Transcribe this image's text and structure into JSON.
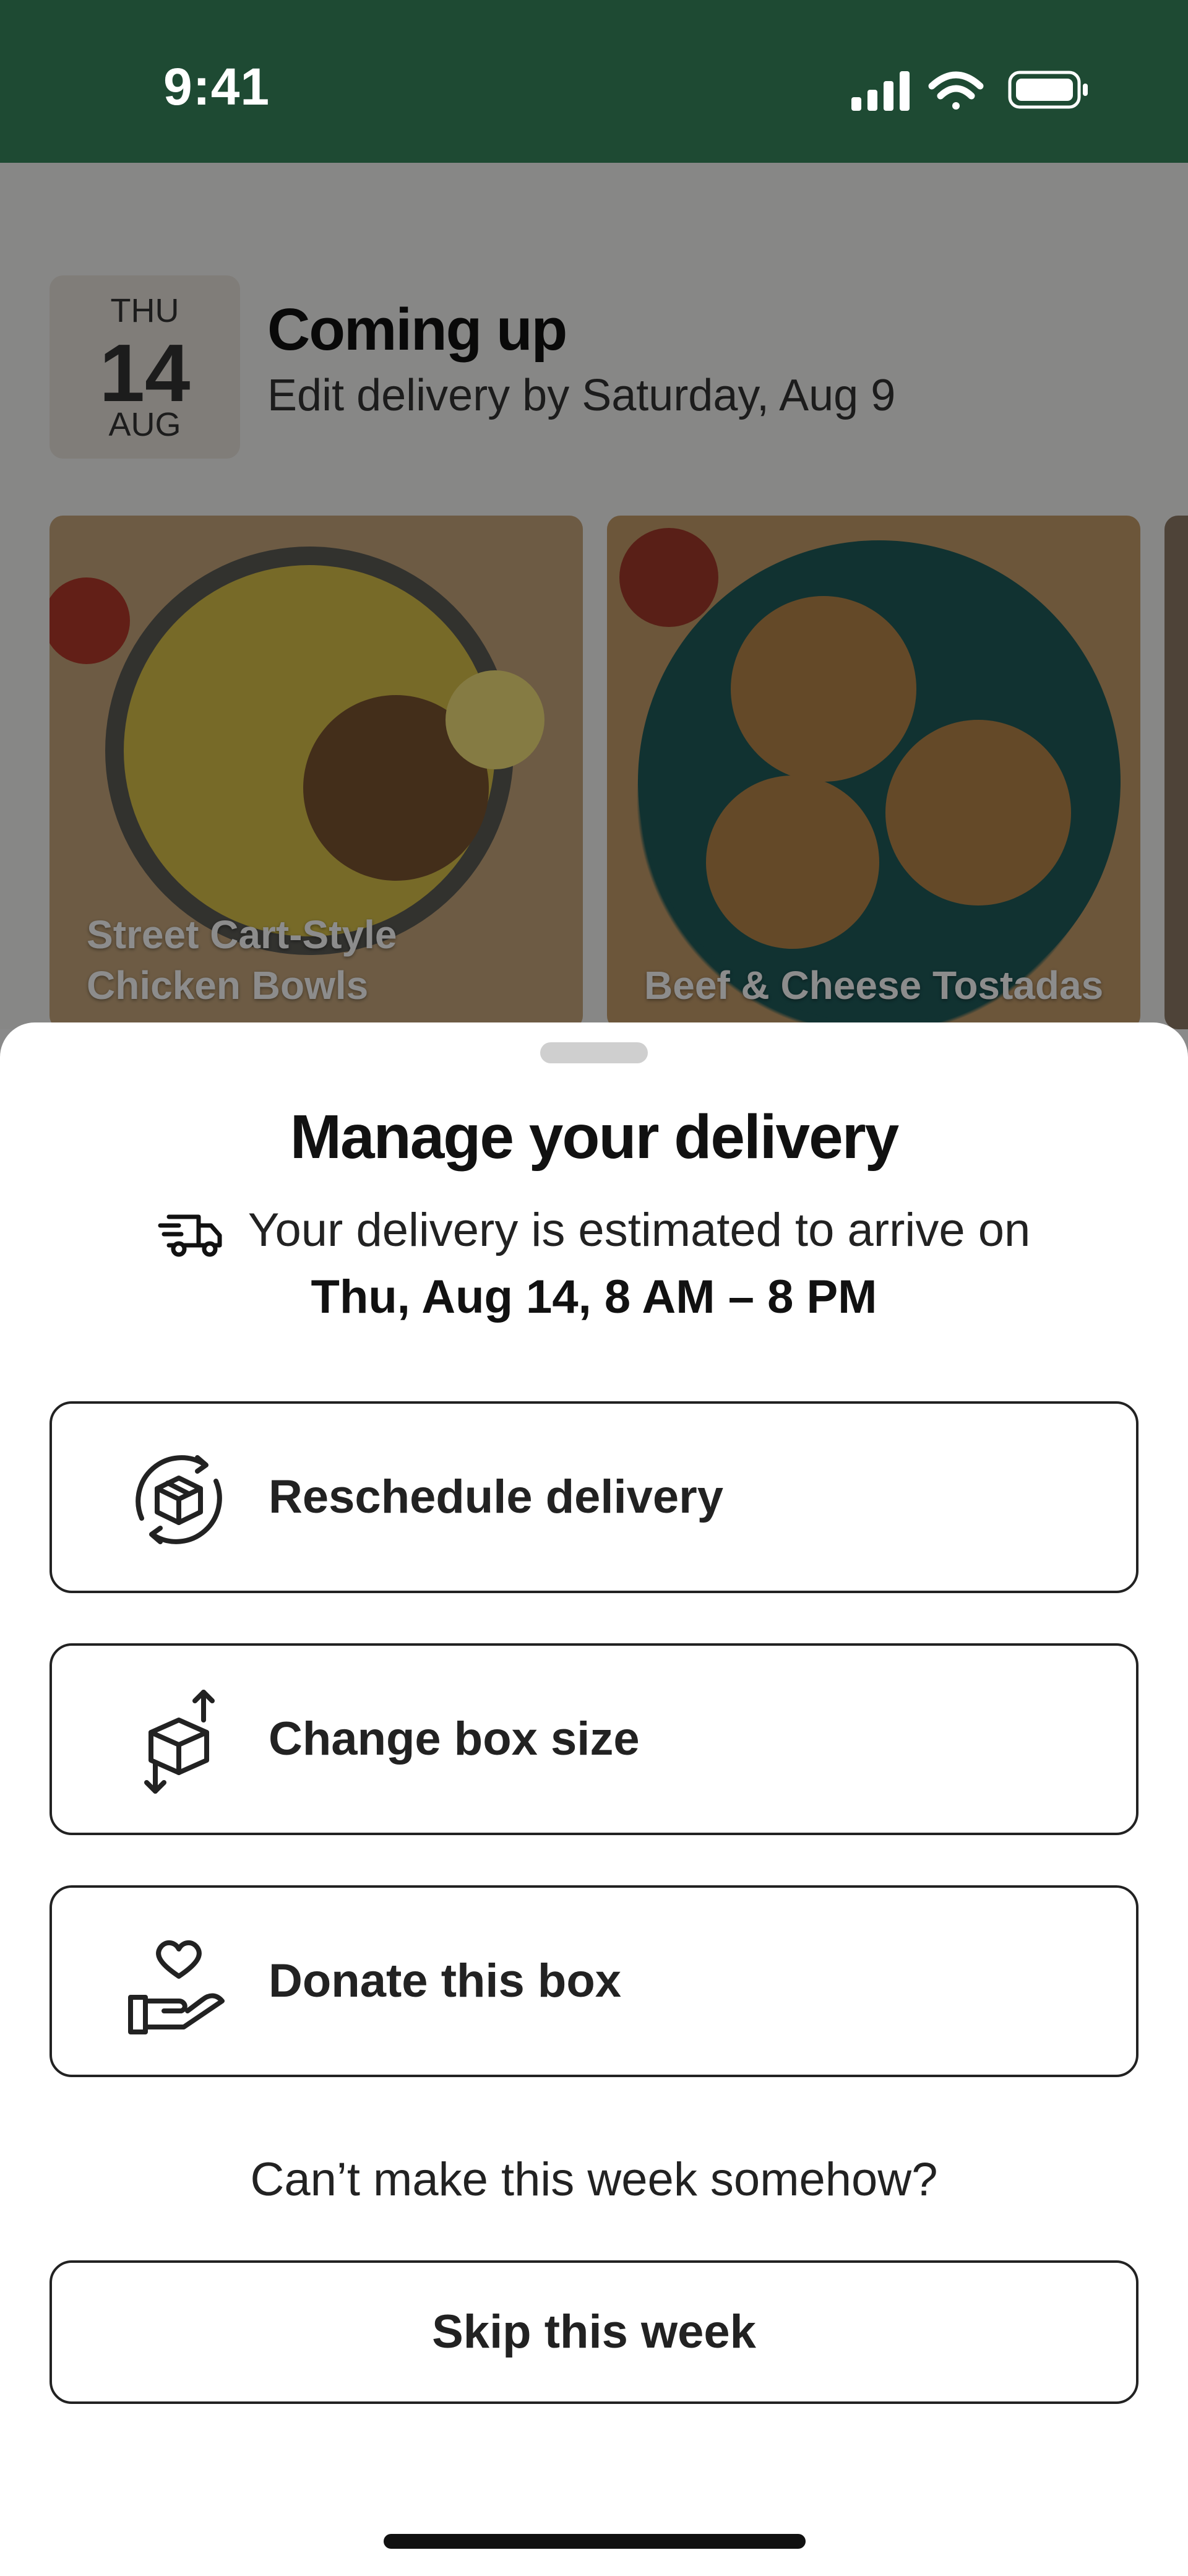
{
  "status_bar": {
    "time": "9:41",
    "icons": [
      "cellular-signal-icon",
      "wifi-icon",
      "battery-icon"
    ],
    "background": "#1e4a33"
  },
  "header": {
    "date_chip": {
      "day_of_week": "THU",
      "day": "14",
      "month": "AUG"
    },
    "title": "Coming up",
    "subtitle": "Edit delivery by Saturday, Aug 9"
  },
  "recipes": [
    {
      "name_line1": "Street Cart-Style",
      "name_line2": "Chicken Bowls"
    },
    {
      "name_line1": "",
      "name_line2": "Beef & Cheese Tostadas"
    }
  ],
  "sheet": {
    "title": "Manage your delivery",
    "eta_text": "Your delivery is estimated to arrive on",
    "eta_date": "Thu, Aug 14, 8 AM – 8 PM",
    "actions": [
      {
        "label": "Reschedule delivery",
        "icon": "reschedule-box-icon"
      },
      {
        "label": "Change box size",
        "icon": "box-resize-icon"
      },
      {
        "label": "Donate this box",
        "icon": "donate-heart-hand-icon"
      }
    ],
    "prompt": "Can’t make this week somehow?",
    "skip_label": "Skip this week"
  }
}
